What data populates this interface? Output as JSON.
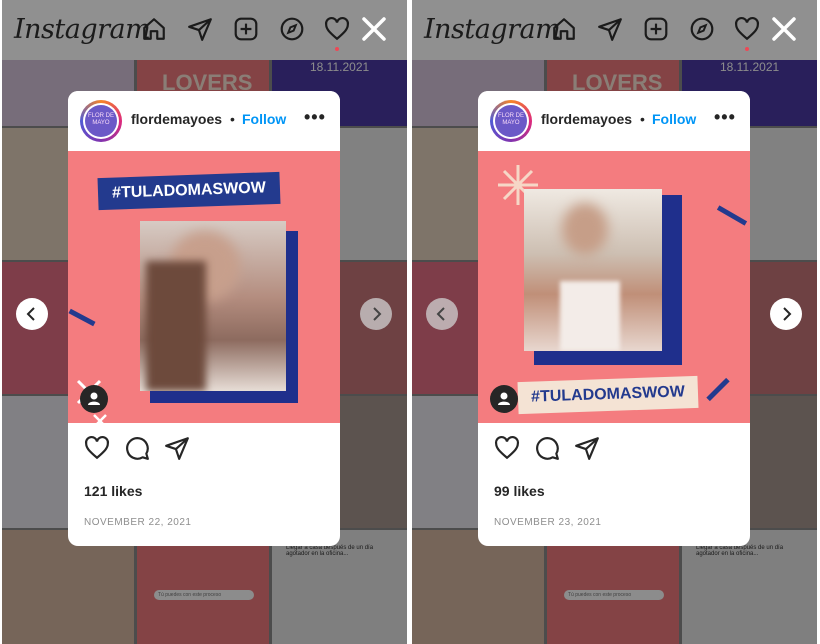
{
  "app": {
    "brand": "Instagram"
  },
  "panels": [
    {
      "post": {
        "username": "flordemayoes",
        "separator": "•",
        "follow_label": "Follow",
        "more_label": "•••",
        "avatar_text": "FLOR DE MAYO",
        "hashtag": "#TULADOMASWOW",
        "likes": "121 likes",
        "date": "NOVEMBER 22, 2021"
      }
    },
    {
      "post": {
        "username": "flordemayoes",
        "separator": "•",
        "follow_label": "Follow",
        "more_label": "•••",
        "avatar_text": "FLOR DE MAYO",
        "hashtag": "#TULADOMASWOW",
        "likes": "99 likes",
        "date": "NOVEMBER 23, 2021"
      }
    }
  ],
  "background": {
    "banner_text": "LOVERS",
    "date_badge": "18.11.2021",
    "caption_text": "Llegar a casa después de un día agotador en la oficina...",
    "search_placeholder": "Tú puedes con este proceso"
  },
  "colors": {
    "post_bg": "#f47c7f",
    "navy": "#233a8e",
    "follow": "#0095f6",
    "notification_dot": "#ed4956"
  },
  "icons": [
    "home-icon",
    "direct-icon",
    "new-post-icon",
    "explore-icon",
    "activity-icon",
    "close-icon",
    "like-icon",
    "comment-icon",
    "share-icon",
    "chevron-left-icon",
    "chevron-right-icon",
    "user-tag-icon"
  ]
}
